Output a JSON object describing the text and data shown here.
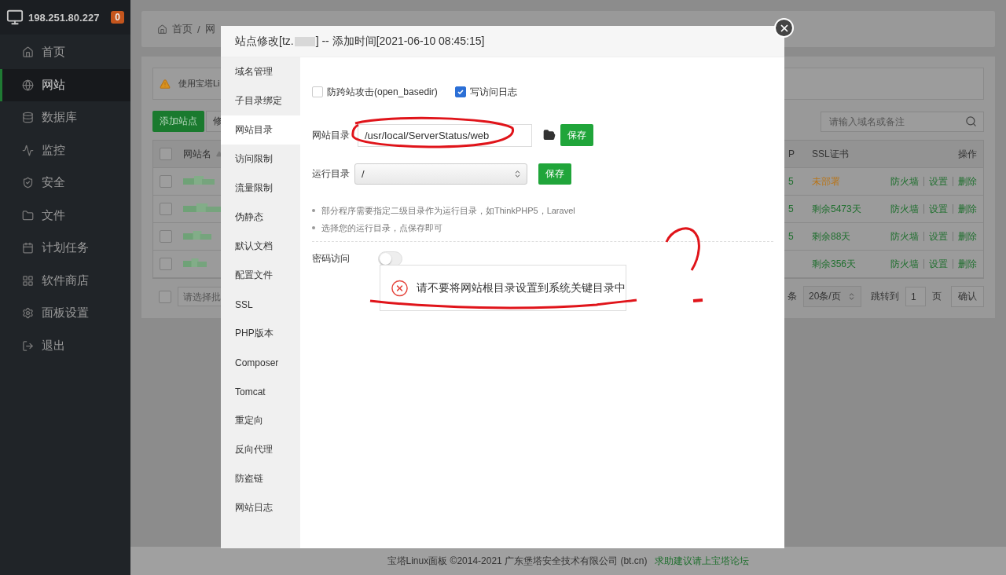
{
  "header": {
    "host": "198.251.80.227",
    "badge": "0"
  },
  "sidebar": {
    "items": [
      {
        "label": "首页",
        "selected": false
      },
      {
        "label": "网站",
        "selected": true
      },
      {
        "label": "数据库",
        "selected": false
      },
      {
        "label": "监控",
        "selected": false
      },
      {
        "label": "安全",
        "selected": false
      },
      {
        "label": "文件",
        "selected": false
      },
      {
        "label": "计划任务",
        "selected": false
      },
      {
        "label": "软件商店",
        "selected": false
      },
      {
        "label": "面板设置",
        "selected": false
      },
      {
        "label": "退出",
        "selected": false
      }
    ]
  },
  "breadcrumb": {
    "items": [
      "首页",
      "网"
    ],
    "separator": "/"
  },
  "notice": {
    "text": "使用宝塔Li"
  },
  "toolbar": {
    "buttons": [
      "添加站点",
      "修"
    ],
    "search": {
      "placeholder": "请输入域名或备注"
    }
  },
  "table": {
    "select_all_checked": false,
    "columns": [
      "网站名",
      "P",
      "SSL证书",
      "操作"
    ],
    "rows": [
      {
        "checked": false,
        "column_2": "5",
        "ssl": {
          "text": "未部署",
          "color": "#b8751a"
        },
        "actions": [
          "防火墙",
          "设置",
          "删除"
        ]
      },
      {
        "checked": false,
        "column_2": "5",
        "ssl": {
          "text": "剩余5473天",
          "color": "#1f6f2e"
        },
        "actions": [
          "防火墙",
          "设置",
          "删除"
        ]
      },
      {
        "checked": false,
        "column_2": "5",
        "ssl": {
          "text": "剩余88天",
          "color": "#1f6f2e"
        },
        "actions": [
          "防火墙",
          "设置",
          "删除"
        ]
      },
      {
        "checked": false,
        "ssl": {
          "text": "剩余356天",
          "color": "#1f6f2e"
        },
        "actions": [
          "防火墙",
          "设置",
          "删除"
        ]
      }
    ]
  },
  "pagination": {
    "select_all_checked": false,
    "batch_placeholder": "请选择批",
    "count_suffix": "条",
    "page_size": "20条/页",
    "jump_label": "跳转到",
    "page": "1",
    "page_unit": "页",
    "confirm": "确认"
  },
  "footer": {
    "text": "宝塔Linux面板 ©2014-2021 广东堡塔安全技术有限公司 (bt.cn)",
    "link": "求助建议请上宝塔论坛"
  },
  "dialog": {
    "title_prefix": "站点修改[tz.",
    "title_suffix": "] -- 添加时间[2021-06-10 08:45:15]",
    "tabs": [
      {
        "label": "域名管理",
        "selected": false
      },
      {
        "label": "子目录绑定",
        "selected": false
      },
      {
        "label": "网站目录",
        "selected": true
      },
      {
        "label": "访问限制",
        "selected": false
      },
      {
        "label": "流量限制",
        "selected": false
      },
      {
        "label": "伪静态",
        "selected": false
      },
      {
        "label": "默认文档",
        "selected": false
      },
      {
        "label": "配置文件",
        "selected": false
      },
      {
        "label": "SSL",
        "selected": false
      },
      {
        "label": "PHP版本",
        "selected": false
      },
      {
        "label": "Composer",
        "selected": false
      },
      {
        "label": "Tomcat",
        "selected": false
      },
      {
        "label": "重定向",
        "selected": false
      },
      {
        "label": "反向代理",
        "selected": false
      },
      {
        "label": "防盗链",
        "selected": false
      },
      {
        "label": "网站日志",
        "selected": false
      }
    ],
    "options": [
      {
        "label": "防跨站攻击(open_basedir)",
        "checked": false
      },
      {
        "label": "写访问日志",
        "checked": true
      }
    ],
    "site_dir": {
      "label": "网站目录",
      "value": "/usr/local/ServerStatus/web",
      "button": "保存"
    },
    "run_dir": {
      "label": "运行目录",
      "value": "/",
      "button": "保存"
    },
    "tips": [
      "部分程序需要指定二级目录作为运行目录，如ThinkPHP5，Laravel",
      "选择您的运行目录，点保存即可"
    ],
    "password_access": {
      "label": "密码访问",
      "on": false
    },
    "toast": {
      "text": "请不要将网站根目录设置到系统关键目录中"
    }
  }
}
